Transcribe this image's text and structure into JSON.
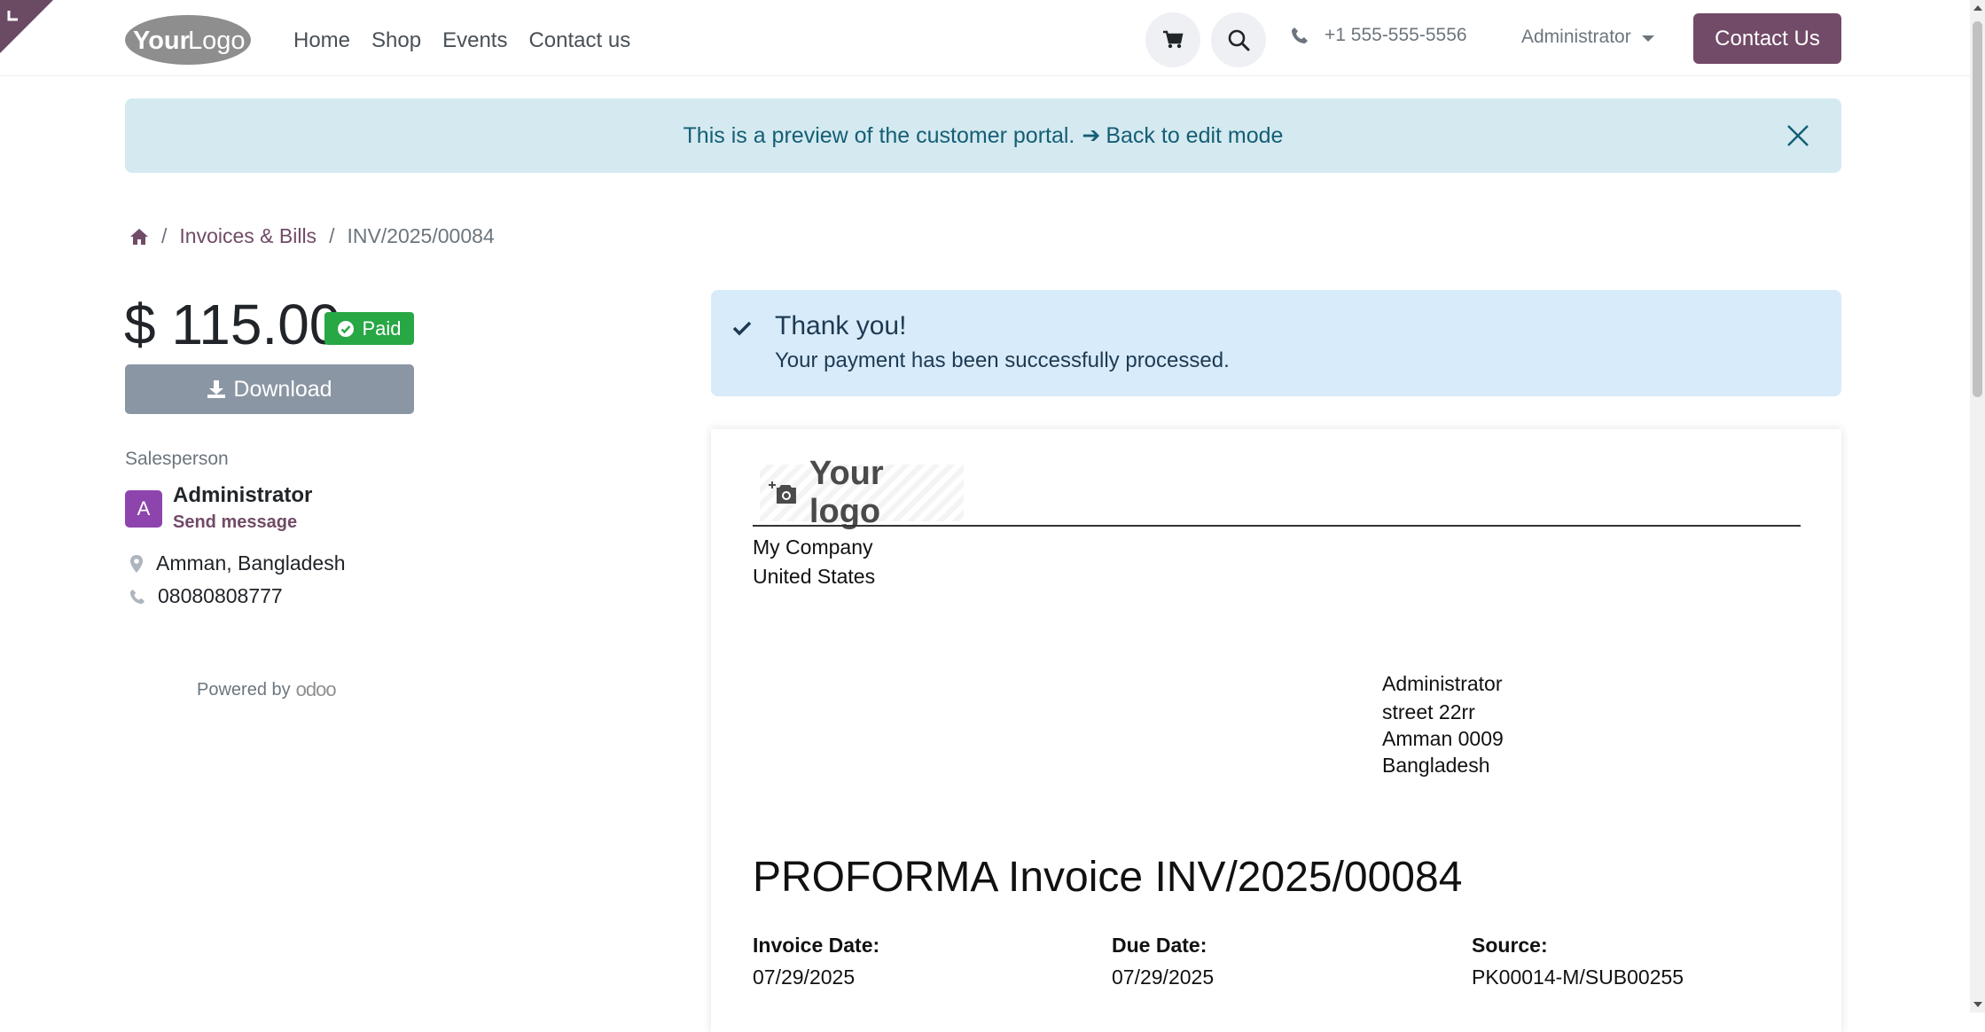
{
  "header": {
    "logo_text_1": "Your",
    "logo_text_2": "Logo",
    "nav": [
      "Home",
      "Shop",
      "Events",
      "Contact us"
    ],
    "phone": "+1 555-555-5556",
    "user": "Administrator",
    "contact_button": "Contact Us"
  },
  "banner": {
    "text": "This is a preview of the customer portal.",
    "arrow": "➔",
    "link": "Back to edit mode"
  },
  "breadcrumb": {
    "section": "Invoices & Bills",
    "current": "INV/2025/00084"
  },
  "summary": {
    "amount": "$ 115.00",
    "status": "Paid",
    "download_label": "Download",
    "salesperson_label": "Salesperson",
    "avatar_initial": "A",
    "salesperson_name": "Administrator",
    "send_message": "Send message",
    "address": "Amman, Bangladesh",
    "phone": "08080808777",
    "powered_by": "Powered by",
    "brand": "odoo"
  },
  "payment_alert": {
    "title": "Thank you!",
    "message": "Your payment has been successfully processed."
  },
  "invoice": {
    "logo_text": "Your logo",
    "company_name": "My Company",
    "company_country": "United States",
    "customer_name": "Administrator",
    "customer_street": "street 22rr",
    "customer_city": "Amman 0009",
    "customer_country": "Bangladesh",
    "title": "PROFORMA Invoice INV/2025/00084",
    "invoice_date_label": "Invoice Date:",
    "invoice_date": "07/29/2025",
    "due_date_label": "Due Date:",
    "due_date": "07/29/2025",
    "source_label": "Source:",
    "source": "PK00014-M/SUB00255"
  },
  "colors": {
    "brand": "#714b67",
    "banner_bg": "#d4eaf0",
    "alert_bg": "#d7ebfa",
    "paid": "#28a745",
    "download": "#8a96a3",
    "avatar": "#8e44ad"
  }
}
